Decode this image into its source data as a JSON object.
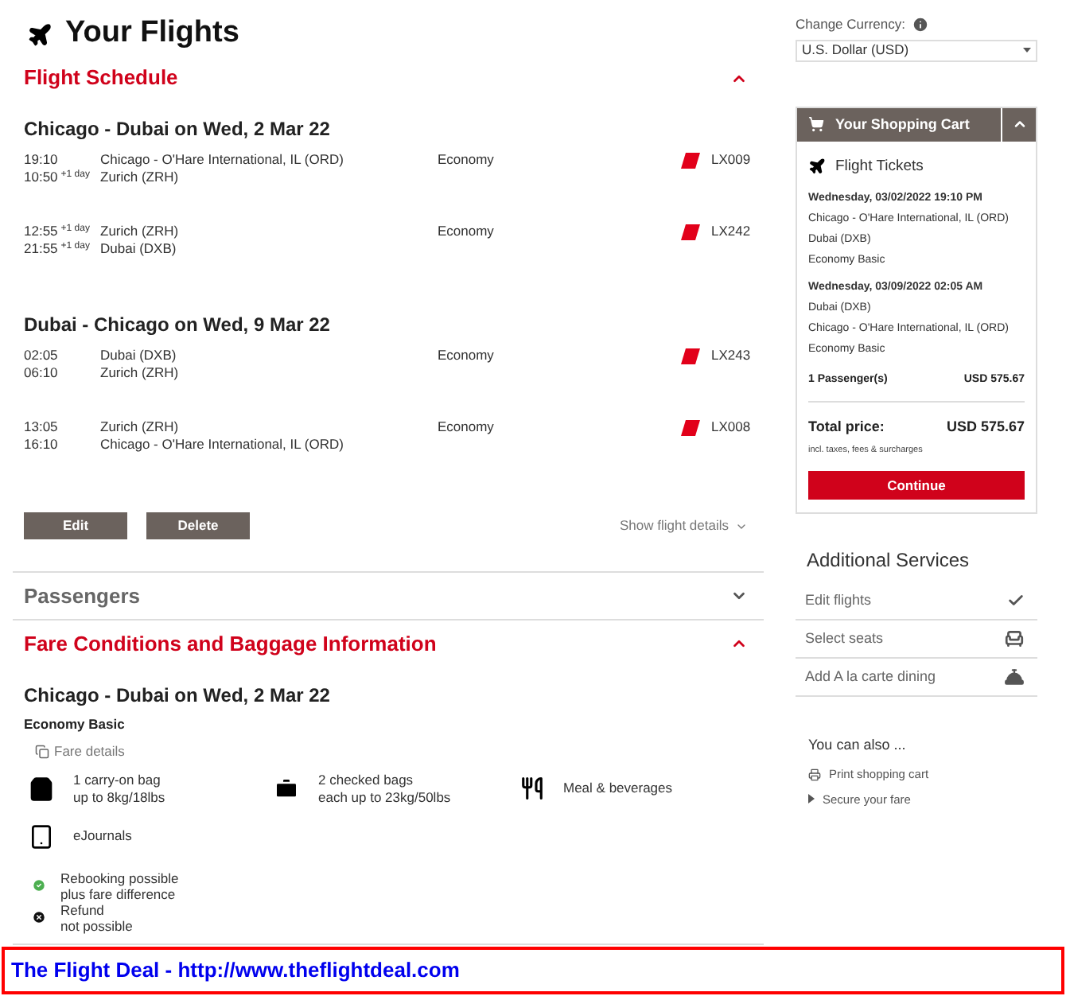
{
  "title": "Your Flights",
  "schedule": {
    "title": "Flight Schedule",
    "expanded": true,
    "journeys": [
      {
        "heading": "Chicago - Dubai on Wed, 2 Mar 22",
        "flights": [
          {
            "dep_time": "19:10",
            "arr_time": "10:50",
            "arr_offset": "+1 day",
            "from": "Chicago - O'Hare International, IL (ORD)",
            "to": "Zurich (ZRH)",
            "cabin": "Economy",
            "number": "LX009"
          },
          {
            "dep_time": "12:55",
            "dep_offset": "+1 day",
            "arr_time": "21:55",
            "arr_offset": "+1 day",
            "from": "Zurich (ZRH)",
            "to": "Dubai (DXB)",
            "cabin": "Economy",
            "number": "LX242"
          }
        ]
      },
      {
        "heading": "Dubai - Chicago on Wed, 9 Mar 22",
        "flights": [
          {
            "dep_time": "02:05",
            "arr_time": "06:10",
            "from": "Dubai (DXB)",
            "to": "Zurich (ZRH)",
            "cabin": "Economy",
            "number": "LX243"
          },
          {
            "dep_time": "13:05",
            "arr_time": "16:10",
            "from": "Zurich (ZRH)",
            "to": "Chicago - O'Hare International, IL (ORD)",
            "cabin": "Economy",
            "number": "LX008"
          }
        ]
      }
    ],
    "buttons": [
      "Edit",
      "Delete"
    ],
    "details_link": "Show flight details"
  },
  "passengers": {
    "title": "Passengers",
    "expanded": false
  },
  "fare": {
    "title": "Fare Conditions and Baggage Information",
    "expanded": true,
    "heading": "Chicago - Dubai on Wed, 2 Mar 22",
    "fare_name": "Economy Basic",
    "details_link": "Fare details",
    "amenities": [
      {
        "kind": "carry_on",
        "lines": [
          "1 carry-on bag",
          "up to 8kg/18lbs"
        ]
      },
      {
        "kind": "checked",
        "lines": [
          "2 checked bags",
          "each up to 23kg/50lbs"
        ]
      },
      {
        "kind": "meal",
        "lines": [
          "Meal & beverages"
        ]
      },
      {
        "kind": "journal",
        "lines": [
          "eJournals"
        ]
      }
    ],
    "conditions": [
      {
        "possible": true,
        "lines": [
          "Rebooking possible",
          "plus fare difference"
        ]
      },
      {
        "possible": false,
        "lines": [
          "Refund",
          "not possible"
        ]
      }
    ]
  },
  "currency": {
    "label": "Change Currency:",
    "value": "U.S. Dollar (USD)"
  },
  "cart": {
    "title": "Your Shopping Cart",
    "expanded": true,
    "section_title": "Flight Tickets",
    "bookings": [
      {
        "date": "Wednesday, 03/02/2022 19:10 PM",
        "from": "Chicago - O'Hare International, IL (ORD)",
        "to": "Dubai (DXB)",
        "fare": "Economy Basic"
      },
      {
        "date": "Wednesday, 03/09/2022 02:05 AM",
        "from": "Dubai (DXB)",
        "to": "Chicago - O'Hare International, IL (ORD)",
        "fare": "Economy Basic"
      }
    ],
    "passengers_label": "1 Passenger(s)",
    "passengers_price": "USD 575.67",
    "total_label": "Total price:",
    "total_price": "USD 575.67",
    "note": "incl. taxes, fees & surcharges",
    "button": "Continue"
  },
  "services": {
    "title": "Additional Services",
    "items": [
      {
        "kind": "check",
        "label": "Edit flights"
      },
      {
        "kind": "seat",
        "label": "Select seats"
      },
      {
        "kind": "dining",
        "label": "Add A la carte dining"
      }
    ]
  },
  "more": {
    "title": "You can also ...",
    "links": [
      {
        "kind": "print",
        "label": "Print shopping cart"
      },
      {
        "kind": "arrow",
        "label": "Secure your fare"
      }
    ]
  },
  "footer": "The Flight Deal - http://www.theflightdeal.com"
}
